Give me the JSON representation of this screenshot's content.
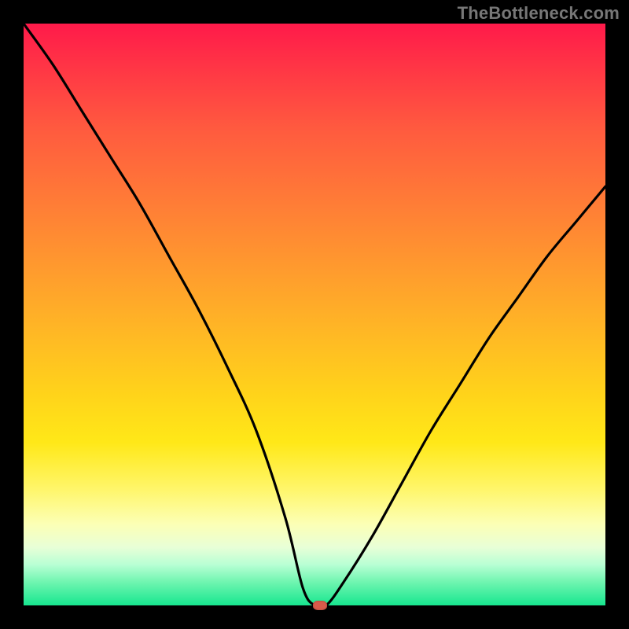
{
  "source_label": "TheBottleneck.com",
  "chart_data": {
    "type": "line",
    "title": "",
    "xlabel": "",
    "ylabel": "",
    "xlim": [
      0,
      100
    ],
    "ylim": [
      0,
      100
    ],
    "series": [
      {
        "name": "bottleneck-curve",
        "x": [
          0,
          5,
          10,
          15,
          20,
          25,
          30,
          35,
          40,
          45,
          48,
          50,
          52,
          55,
          60,
          65,
          70,
          75,
          80,
          85,
          90,
          95,
          100
        ],
        "y": [
          100,
          93,
          85,
          77,
          69,
          60,
          51,
          41,
          30,
          15,
          3,
          0,
          0,
          4,
          12,
          21,
          30,
          38,
          46,
          53,
          60,
          66,
          72
        ]
      }
    ],
    "marker": {
      "x": 51,
      "y": 0
    },
    "gradient_stops": [
      {
        "pct": 0,
        "color": "#ff1a4a"
      },
      {
        "pct": 50,
        "color": "#ffba24"
      },
      {
        "pct": 80,
        "color": "#fff66a"
      },
      {
        "pct": 100,
        "color": "#17e68f"
      }
    ]
  }
}
